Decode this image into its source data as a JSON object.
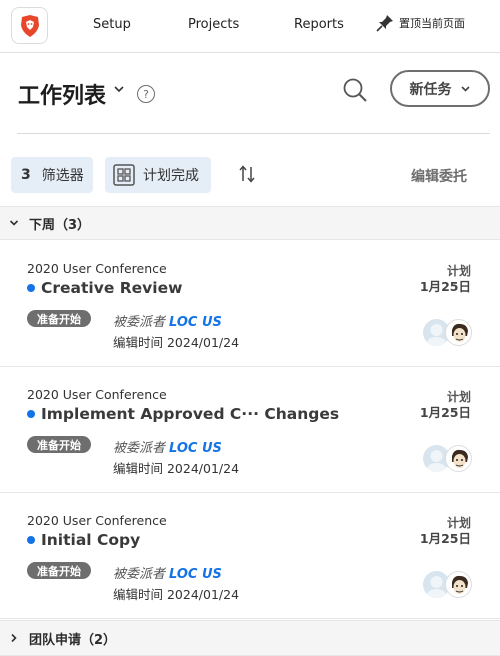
{
  "topbar": {
    "logo_icon": "lion-shield-icon",
    "nav": [
      "Setup",
      "Projects",
      "Reports"
    ],
    "pin_label": "置顶当前页面"
  },
  "header": {
    "title": "工作列表",
    "help": "?",
    "new_task_label": "新任务"
  },
  "toolbar": {
    "filter_count": "3",
    "filter_label": "筛选器",
    "plan_label": "计划完成",
    "delegate_label": "编辑委托"
  },
  "groups": [
    {
      "label": "下周（3）",
      "expanded": true
    },
    {
      "label": "团队申请（2）",
      "expanded": false
    }
  ],
  "tasks": [
    {
      "project": "2020 User Conference",
      "name": "Creative Review",
      "status": "准备开始",
      "delegator_prefix": "被委派者",
      "delegator_name": "LOC US",
      "edited": "编辑时间 2024/01/24",
      "plan_label": "计划",
      "plan_date": "1月25日"
    },
    {
      "project": "2020 User Conference",
      "name": "Implement Approved C···  Changes",
      "status": "准备开始",
      "delegator_prefix": "被委派者",
      "delegator_name": "LOC US",
      "edited": "编辑时间 2024/01/24",
      "plan_label": "计划",
      "plan_date": "1月25日"
    },
    {
      "project": "2020 User Conference",
      "name": "Initial Copy",
      "status": "准备开始",
      "delegator_prefix": "被委派者",
      "delegator_name": "LOC US",
      "edited": "编辑时间 2024/01/24",
      "plan_label": "计划",
      "plan_date": "1月25日"
    }
  ],
  "colors": {
    "accent": "#1473e6",
    "chip_bg": "#e5eef7",
    "status_bg": "#6e6e6e"
  }
}
